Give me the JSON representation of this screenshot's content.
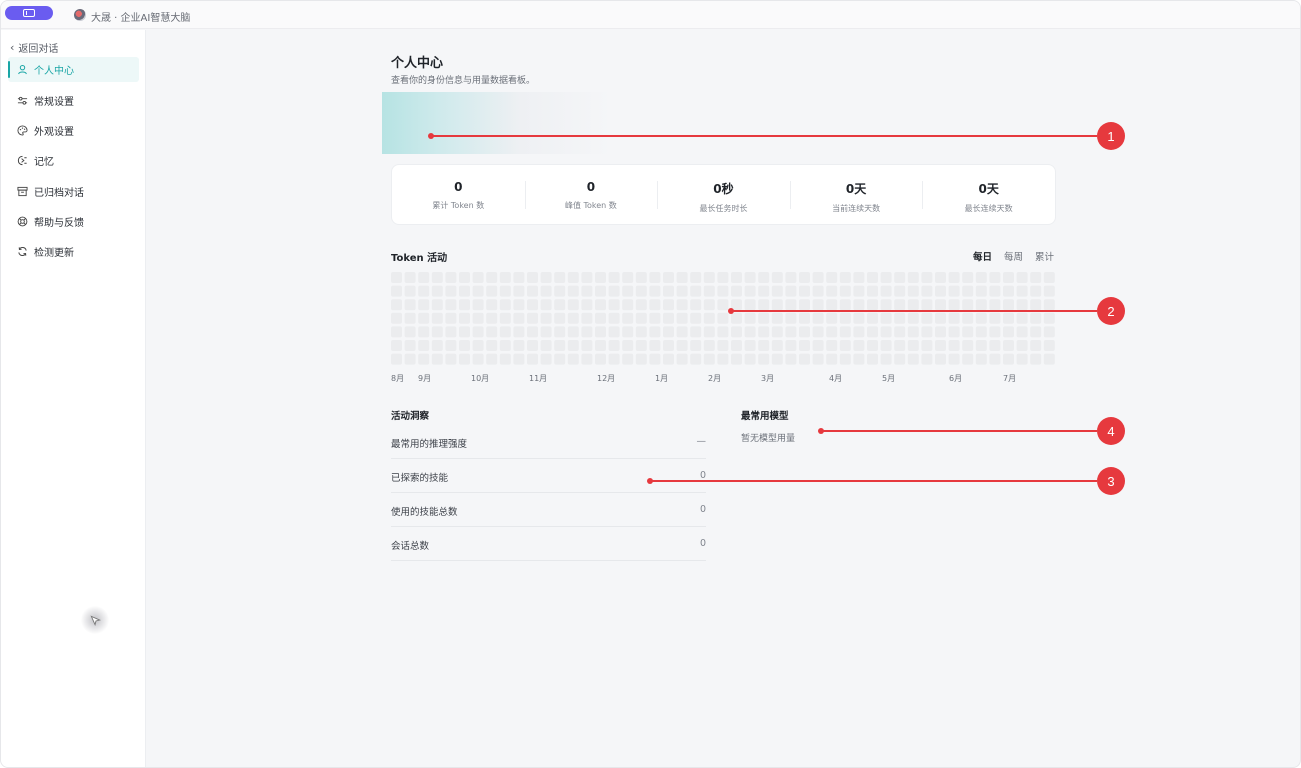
{
  "app": {
    "title": "大晟 · 企业AI智慧大脑",
    "sidebar_toggle_icon": "sidebar-toggle-icon"
  },
  "sidebar": {
    "back_label": "返回对话",
    "items": [
      {
        "label": "个人中心",
        "icon": "user-icon",
        "active": true
      },
      {
        "label": "常规设置",
        "icon": "sliders-icon",
        "active": false
      },
      {
        "label": "外观设置",
        "icon": "palette-icon",
        "active": false
      },
      {
        "label": "记忆",
        "icon": "memory-icon",
        "active": false
      },
      {
        "label": "已归档对话",
        "icon": "archive-icon",
        "active": false
      },
      {
        "label": "帮助与反馈",
        "icon": "help-icon",
        "active": false
      },
      {
        "label": "检测更新",
        "icon": "refresh-icon",
        "active": false
      }
    ]
  },
  "profile": {
    "title": "个人中心",
    "subtitle": "查看你的身份信息与用量数据看板。"
  },
  "stats": [
    {
      "value": "0",
      "label": "累计 Token 数"
    },
    {
      "value": "0",
      "label": "峰值 Token 数"
    },
    {
      "value": "0秒",
      "label": "最长任务时长"
    },
    {
      "value": "0天",
      "label": "当前连续天数"
    },
    {
      "value": "0天",
      "label": "最长连续天数"
    }
  ],
  "activity": {
    "title": "Token 活动",
    "tabs": [
      {
        "label": "每日",
        "active": true
      },
      {
        "label": "每周",
        "active": false
      },
      {
        "label": "累计",
        "active": false
      }
    ],
    "months": [
      "8月",
      "9月",
      "10月",
      "11月",
      "12月",
      "1月",
      "2月",
      "3月",
      "4月",
      "5月",
      "6月",
      "7月"
    ]
  },
  "insights": {
    "title": "活动洞察",
    "rows": [
      {
        "label": "最常用的推理强度",
        "value": "—"
      },
      {
        "label": "已探索的技能",
        "value": "0"
      },
      {
        "label": "使用的技能总数",
        "value": "0"
      },
      {
        "label": "会话总数",
        "value": "0"
      }
    ]
  },
  "models": {
    "title": "最常用模型",
    "empty": "暂无模型用量"
  },
  "callouts": [
    "1",
    "2",
    "3",
    "4"
  ],
  "colors": {
    "accent": "#1aa6a6",
    "callout": "#e6393e",
    "toggle": "#6a5cf0",
    "heat_cell": "#ebecee"
  }
}
